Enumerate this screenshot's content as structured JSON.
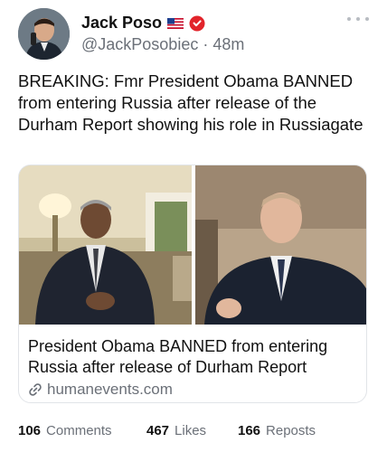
{
  "author": {
    "display_name": "Jack Poso",
    "handle": "@JackPosobiec",
    "time": "48m",
    "separator": "·"
  },
  "post": {
    "text": "BREAKING: Fmr President Obama BANNED from entering Russia after release of the Durham Report showing his role in Russiagate"
  },
  "link_card": {
    "title": "President Obama BANNED from entering Russia after release of Durham Report",
    "domain": "humanevents.com"
  },
  "stats": {
    "comments_count": "106",
    "comments_label": "Comments",
    "likes_count": "467",
    "likes_label": "Likes",
    "reposts_count": "166",
    "reposts_label": "Reposts"
  },
  "colors": {
    "verified_badge": "#e2242b",
    "secondary_text": "#6b7078"
  },
  "icons": [
    "us-flag-icon",
    "verified-badge-icon",
    "more-options-icon",
    "link-icon"
  ]
}
